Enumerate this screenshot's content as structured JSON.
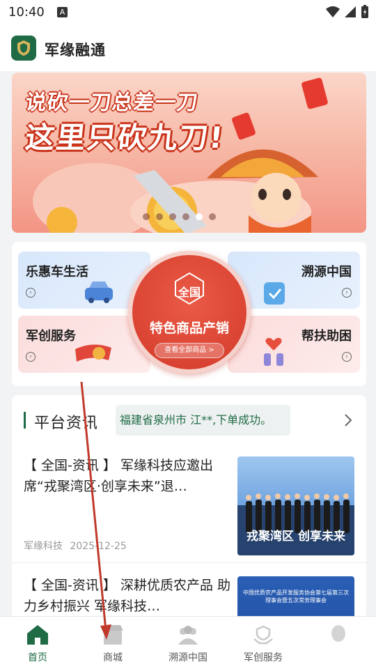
{
  "status": {
    "time": "10:40",
    "notif_letter": "A"
  },
  "app": {
    "title": "军缘融通"
  },
  "banner": {
    "line1": "说砍一刀总差一刀",
    "line2": "这里只砍九刀!",
    "dots": 6,
    "active_dot": 4
  },
  "features": {
    "tiles": [
      {
        "label": "乐惠车生活"
      },
      {
        "label": "溯源中国"
      },
      {
        "label": "军创服务"
      },
      {
        "label": "帮扶助困"
      }
    ],
    "center": {
      "badge": "全国",
      "title": "特色商品产销",
      "link": "查看全部商品 >"
    }
  },
  "news": {
    "title": "平台资讯",
    "ticker": "福建省泉州市 江**,下单成功。",
    "articles": [
      {
        "title": "【 全国-资讯 】 军缘科技应邀出席“戎聚湾区·创享未来”退…",
        "source": "军缘科技",
        "date": "2025-12-25",
        "thumb_text": "戎聚湾区 创享未来"
      },
      {
        "title": "【 全国-资讯 】 深耕优质农产品 助力乡村振兴 军缘科技…",
        "source": "",
        "date": "",
        "thumb_text": "中国优质农产品开发服务协会第七届第三次理事会暨五次常务理事会"
      }
    ]
  },
  "tabbar": {
    "tabs": [
      {
        "label": "首页",
        "icon": "home-icon",
        "active": true
      },
      {
        "label": "商城",
        "icon": "shop-icon",
        "active": false
      },
      {
        "label": "溯源中国",
        "icon": "people-icon",
        "active": false
      },
      {
        "label": "军创服务",
        "icon": "service-icon",
        "active": false
      },
      {
        "label": "",
        "icon": "profile-icon",
        "active": false
      }
    ]
  },
  "colors": {
    "brand": "#1e6b45",
    "accent_red": "#d33a2a",
    "annotation_arrow": "#c0392b"
  }
}
